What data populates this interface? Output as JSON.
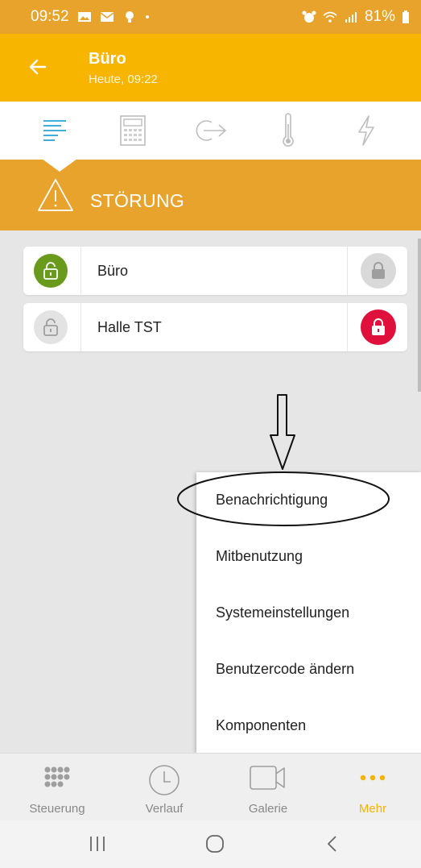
{
  "status_bar": {
    "time": "09:52",
    "battery": "81%",
    "left_icons": [
      "image-icon",
      "mail-icon",
      "bulb-icon"
    ],
    "right_icons": [
      "alarm-icon",
      "wifi-icon",
      "signal-icon",
      "battery-icon"
    ]
  },
  "header": {
    "title": "Büro",
    "subtitle": "Heute, 09:22",
    "back_icon": "arrow-left-icon"
  },
  "tabs": [
    {
      "icon": "list-icon",
      "active": true
    },
    {
      "icon": "calculator-icon",
      "active": false
    },
    {
      "icon": "exit-icon",
      "active": false
    },
    {
      "icon": "thermometer-icon",
      "active": false
    },
    {
      "icon": "lightning-icon",
      "active": false
    }
  ],
  "alert": {
    "text": "STÖRUNG",
    "icon": "warning-icon"
  },
  "zones": [
    {
      "label": "Büro",
      "status": "unlocked-green",
      "right_lock": "locked-gray"
    },
    {
      "label": "Halle TST",
      "status": "unlocked-gray",
      "right_lock": "locked-red"
    }
  ],
  "menu": {
    "items": [
      "Benachrichtigung",
      "Mitbenutzung",
      "Systemeinstellungen",
      "Benutzercode ändern",
      "Komponenten"
    ]
  },
  "bottom_nav": {
    "items": [
      {
        "label": "Steuerung",
        "icon": "grid-icon",
        "active": false
      },
      {
        "label": "Verlauf",
        "icon": "clock-icon",
        "active": false
      },
      {
        "label": "Galerie",
        "icon": "video-icon",
        "active": false
      },
      {
        "label": "Mehr",
        "icon": "more-icon",
        "active": true
      }
    ]
  },
  "colors": {
    "status_bar": "#e8a32c",
    "app_bar": "#f7b500",
    "accent_blue": "#2aa3d6",
    "green": "#6a9a1c",
    "red": "#e0103c",
    "active_nav": "#f0b400"
  }
}
